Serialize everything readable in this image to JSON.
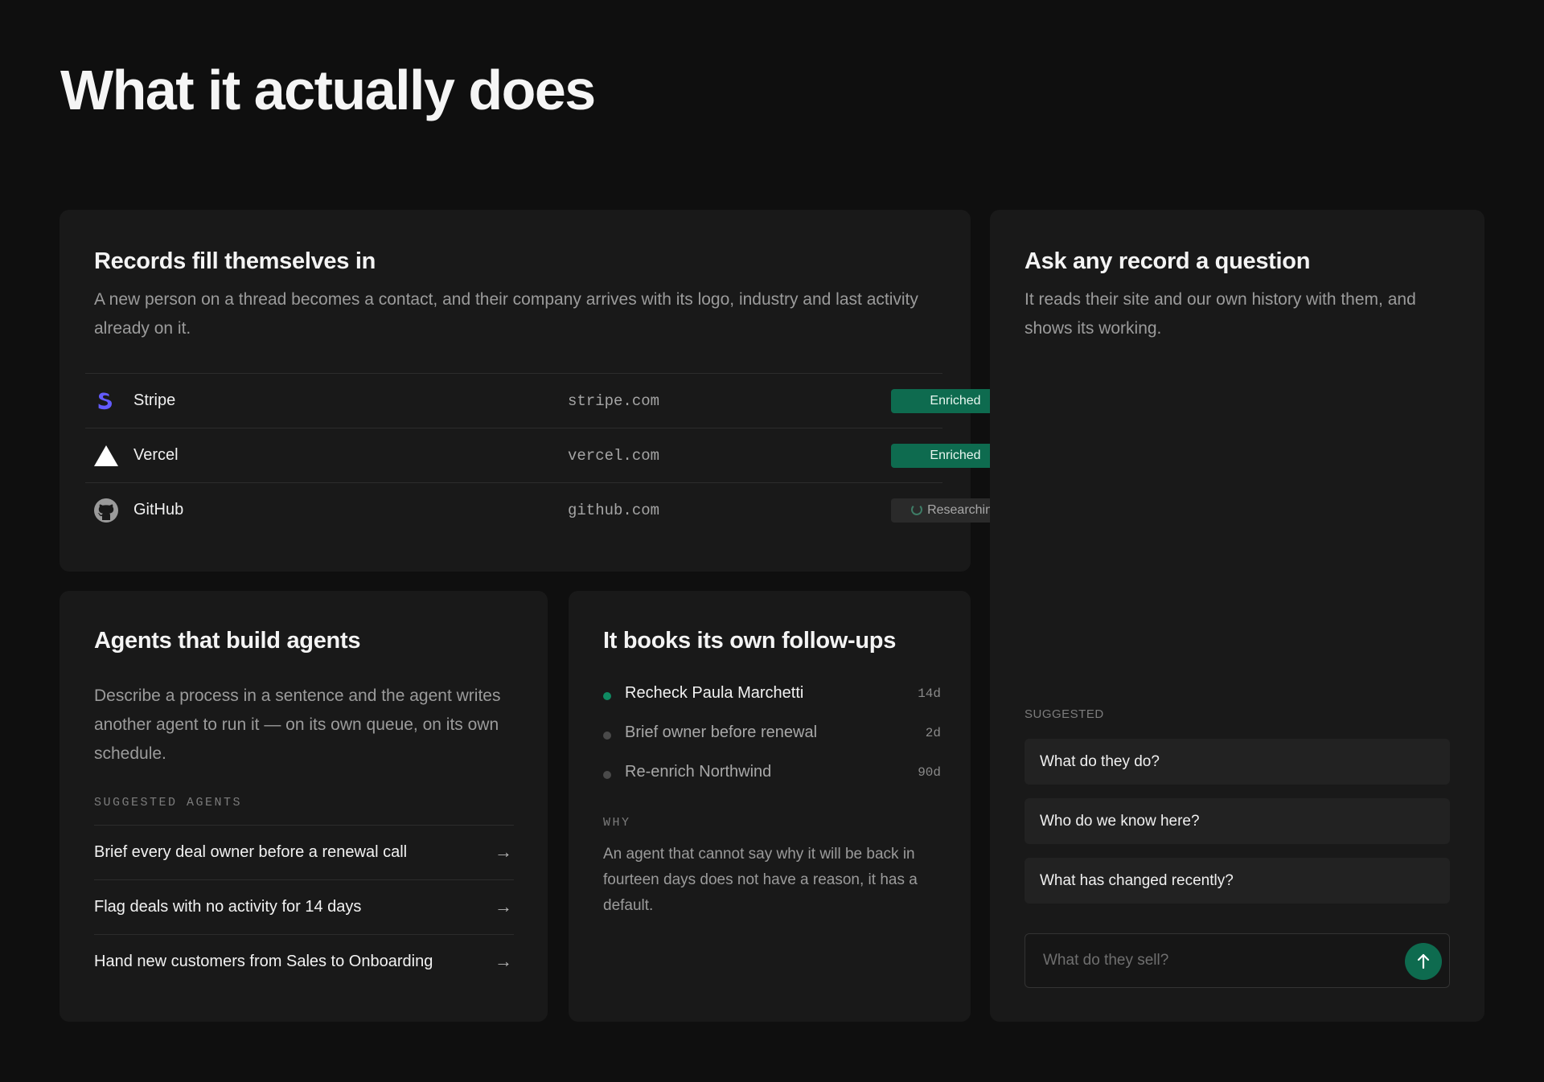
{
  "page": {
    "title": "What it actually does"
  },
  "records_card": {
    "title": "Records fill themselves in",
    "description": "A new person on a thread becomes a contact, and their company arrives with its logo, industry and last activity already on it.",
    "rows": [
      {
        "name": "Stripe",
        "domain": "stripe.com",
        "status": "Enriched",
        "logo": "stripe-logo",
        "brand_color": "#635bff"
      },
      {
        "name": "Vercel",
        "domain": "vercel.com",
        "status": "Enriched",
        "logo": "vercel-logo",
        "brand_color": "#ffffff"
      },
      {
        "name": "GitHub",
        "domain": "github.com",
        "status": "Researching",
        "logo": "github-logo",
        "brand_color": "#9a9a9a"
      }
    ]
  },
  "agents_card": {
    "title": "Agents that build agents",
    "description": "Describe a process in a sentence and the agent writes another agent to run it — on its own queue, on its own schedule.",
    "section_label": "SUGGESTED AGENTS",
    "items": [
      {
        "label": "Brief every deal owner before a renewal call"
      },
      {
        "label": "Flag deals with no activity for 14 days"
      },
      {
        "label": "Hand new customers from Sales to Onboarding"
      }
    ]
  },
  "followups_card": {
    "title": "It books its own follow-ups",
    "items": [
      {
        "label": "Recheck Paula Marchetti",
        "when": "14d",
        "active": true
      },
      {
        "label": "Brief owner before renewal",
        "when": "2d",
        "active": false
      },
      {
        "label": "Re-enrich Northwind",
        "when": "90d",
        "active": false
      }
    ],
    "why_label": "WHY",
    "why_text": "An agent that cannot say why it will be back in fourteen days does not have a reason, it has a default."
  },
  "ask_card": {
    "title": "Ask any record a question",
    "description": "It reads their site and our own history with them, and shows its working.",
    "suggested_label": "SUGGESTED",
    "suggestions": [
      {
        "label": "What do they do?"
      },
      {
        "label": "Who do we know here?"
      },
      {
        "label": "What has changed recently?"
      }
    ],
    "input_placeholder": "What do they sell?"
  },
  "colors": {
    "background": "#0f0f0f",
    "card": "#191919",
    "accent_green": "#0e6b4f",
    "active_dot": "#0f8a62",
    "inactive_dot": "#4a4a4a"
  }
}
